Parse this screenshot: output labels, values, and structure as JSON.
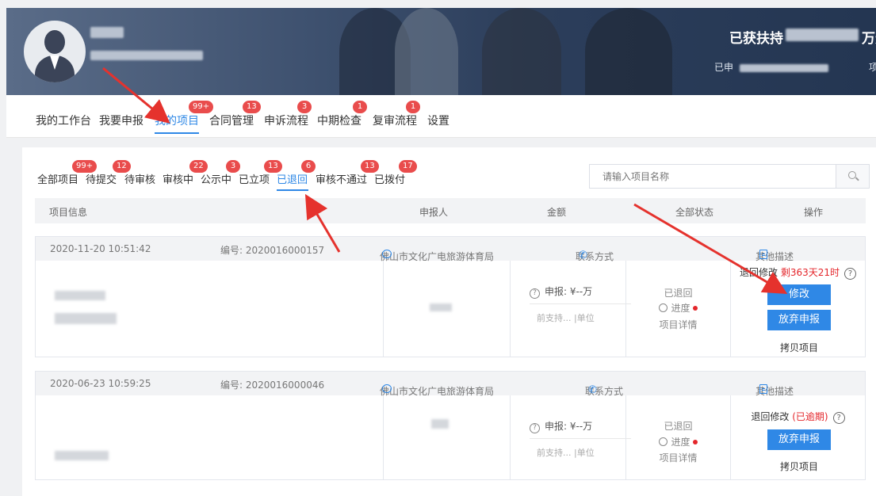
{
  "banner": {
    "supported_label": "已获扶持",
    "supported_unit": "万元",
    "applied_prefix": "已申",
    "project_suffix": "项"
  },
  "main_nav": [
    {
      "label": "我的工作台",
      "badge": ""
    },
    {
      "label": "我要申报",
      "badge": ""
    },
    {
      "label": "我的项目",
      "badge": "99+",
      "active": true
    },
    {
      "label": "合同管理",
      "badge": "13"
    },
    {
      "label": "申诉流程",
      "badge": "3"
    },
    {
      "label": "中期检查",
      "badge": "1"
    },
    {
      "label": "复审流程",
      "badge": "1"
    },
    {
      "label": "设置",
      "badge": ""
    }
  ],
  "sub_nav": [
    {
      "label": "全部项目",
      "badge": "99+"
    },
    {
      "label": "待提交",
      "badge": "12"
    },
    {
      "label": "待审核",
      "badge": ""
    },
    {
      "label": "审核中",
      "badge": "22"
    },
    {
      "label": "公示中",
      "badge": "3"
    },
    {
      "label": "已立项",
      "badge": "13"
    },
    {
      "label": "已退回",
      "badge": "6",
      "active": true
    },
    {
      "label": "审核不通过",
      "badge": "13"
    },
    {
      "label": "已拨付",
      "badge": "17"
    }
  ],
  "search": {
    "placeholder": "请输入项目名称"
  },
  "table_header": {
    "info": "项目信息",
    "applicant": "申报人",
    "amount": "金额",
    "status": "全部状态",
    "ops": "操作"
  },
  "rows": [
    {
      "date": "2020-11-20 10:51:42",
      "number": "编号: 2020016000157",
      "org": "佛山市文化广电旅游体育局",
      "contact": "联系方式",
      "other": "其他描述",
      "amount_declared": "申报: ¥--万",
      "amount_support": "前支持... |单位",
      "status": "已退回",
      "progress": "进度",
      "detail": "项目详情",
      "return_label": "退回修改",
      "return_note": "剩363天21时",
      "edit_btn": "修改",
      "abandon_btn": "放弃申报",
      "copy": "拷贝项目"
    },
    {
      "date": "2020-06-23 10:59:25",
      "number": "编号: 2020016000046",
      "org": "佛山市文化广电旅游体育局",
      "contact": "联系方式",
      "other": "其他描述",
      "amount_declared": "申报: ¥--万",
      "amount_support": "前支持... |单位",
      "status": "已退回",
      "progress": "进度",
      "detail": "项目详情",
      "return_label": "退回修改",
      "return_note": "(已逾期)",
      "abandon_btn": "放弃申报",
      "copy": "拷贝项目"
    }
  ],
  "colors": {
    "accent": "#2f88e6",
    "badge": "#e94c4c",
    "alert": "#e4262b"
  }
}
